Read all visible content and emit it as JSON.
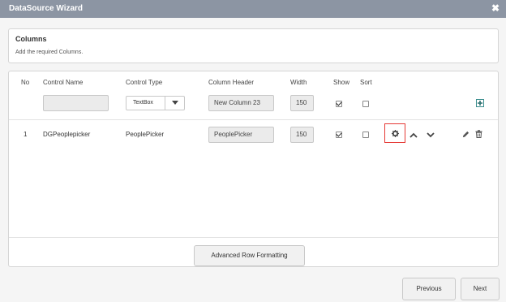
{
  "window": {
    "title": "DataSource Wizard",
    "close_glyph": "✖"
  },
  "section": {
    "title": "Columns",
    "subtitle": "Add the required Columns."
  },
  "table": {
    "headers": {
      "no": "No",
      "control_name": "Control Name",
      "control_type": "Control Type",
      "column_header": "Column Header",
      "width": "Width",
      "show": "Show",
      "sort": "Sort"
    },
    "new_row": {
      "control_name": "",
      "control_type": "TextBox",
      "column_header": "New Column 23",
      "width": "150",
      "show": true,
      "sort": false
    },
    "rows": [
      {
        "no": "1",
        "control_name": "DGPeoplepicker",
        "control_type": "PeoplePicker",
        "column_header": "PeoplePicker",
        "width": "150",
        "show": true,
        "sort": false
      }
    ]
  },
  "buttons": {
    "advanced_row_formatting": "Advanced Row Formatting",
    "previous": "Previous",
    "next": "Next"
  },
  "icons": {
    "add": "plus-square-icon",
    "settings": "gear-icon",
    "up": "chevron-up-icon",
    "down": "chevron-down-icon",
    "edit": "pencil-icon",
    "delete": "trash-icon",
    "caret": "caret-down-icon"
  },
  "colors": {
    "titlebar": "#8c95a3",
    "highlight": "#e53935"
  }
}
